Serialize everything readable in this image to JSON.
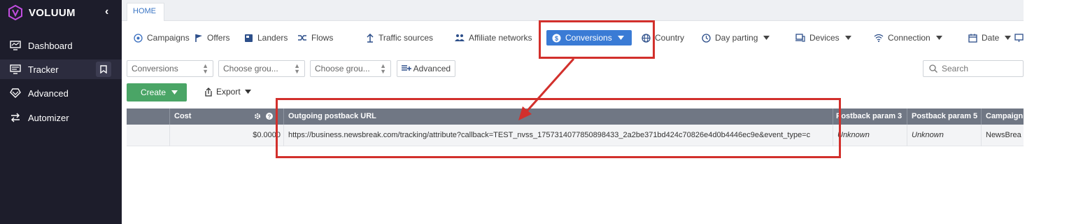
{
  "app": {
    "brand": "VOLUUM"
  },
  "sidebar": {
    "items": [
      {
        "label": "Dashboard",
        "icon": "dashboard-icon"
      },
      {
        "label": "Tracker",
        "icon": "tracker-icon"
      },
      {
        "label": "Advanced",
        "icon": "advanced-icon"
      },
      {
        "label": "Automizer",
        "icon": "automizer-icon"
      }
    ]
  },
  "tabs": {
    "home": "HOME"
  },
  "grouping": {
    "campaigns": "Campaigns",
    "offers": "Offers",
    "landers": "Landers",
    "flows": "Flows",
    "traffic_sources": "Traffic sources",
    "affiliate_networks": "Affiliate networks",
    "conversions": "Conversions",
    "country": "Country",
    "day_parting": "Day parting",
    "devices": "Devices",
    "connection": "Connection",
    "date": "Date"
  },
  "filters": {
    "group1": "Conversions",
    "group2": "Choose grou...",
    "group3": "Choose grou...",
    "advanced": "Advanced",
    "search_placeholder": "Search"
  },
  "actions": {
    "create": "Create",
    "export": "Export"
  },
  "table": {
    "columns": [
      "Cost",
      "Outgoing postback URL",
      "Postback param 3",
      "Postback param 5",
      "Campaign"
    ],
    "row": {
      "cost": "$0.0000",
      "postback_url": "https://business.newsbreak.com/tracking/attribute?callback=TEST_nvss_1757314077850898433_2a2be371bd424c70826e4d0b4446ec9e&event_type=c",
      "param3": "Unknown",
      "param5": "Unknown",
      "campaign": "NewsBrea"
    }
  },
  "colors": {
    "accent": "#3a7bd5",
    "annotation": "#d2302c",
    "create": "#4aa566",
    "sidebar": "#1d1d2b",
    "table_header": "#707784"
  }
}
